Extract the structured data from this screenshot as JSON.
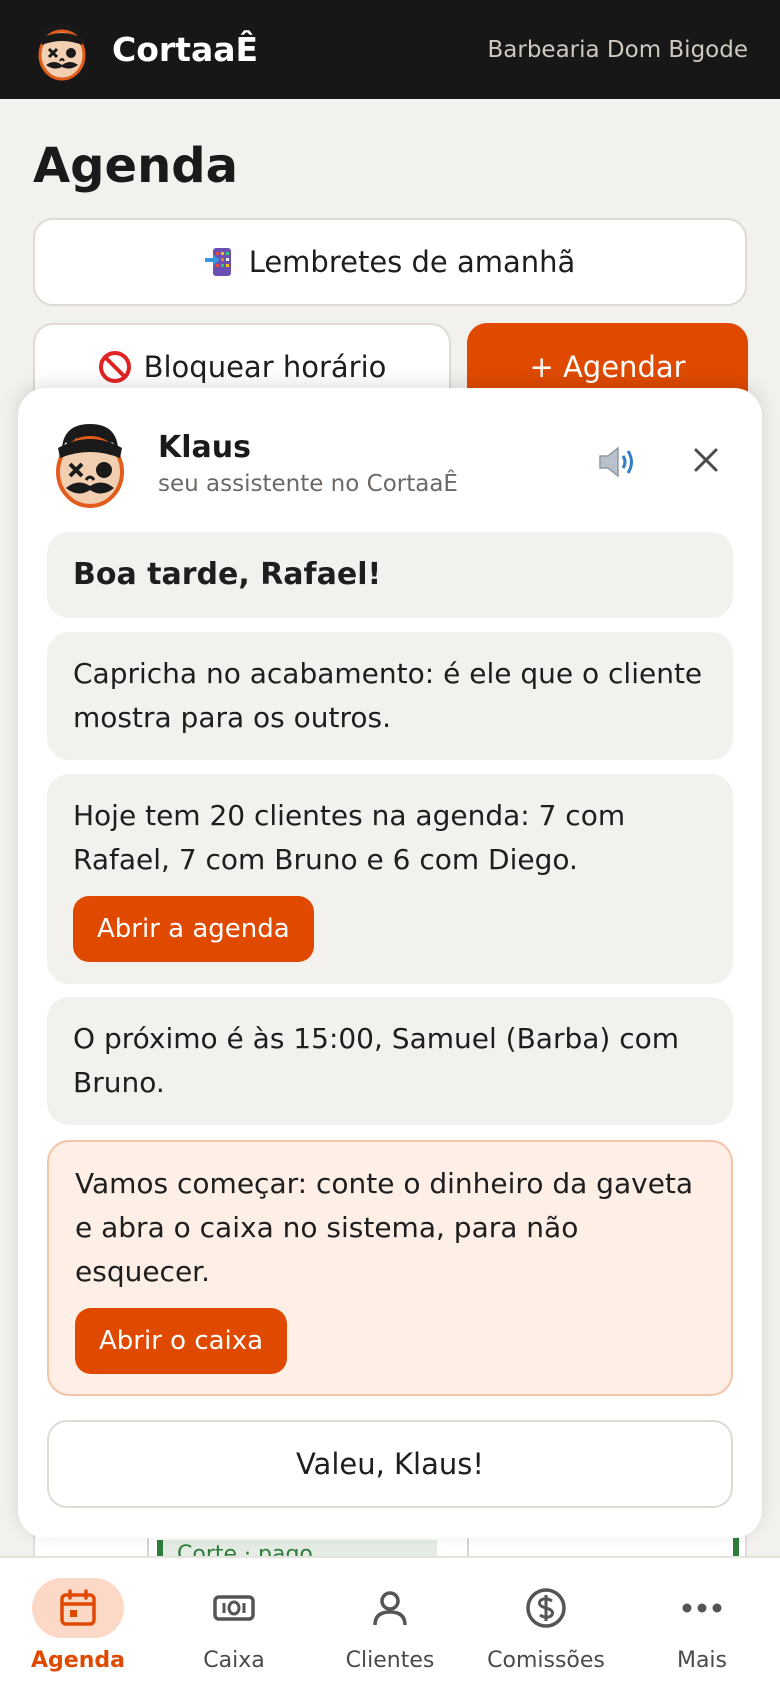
{
  "app": {
    "brand": "CortaaÊ",
    "shop_name": "Barbearia Dom Bigode"
  },
  "page": {
    "title": "Agenda",
    "reminders_button": "Lembretes de amanhã",
    "block_button": "Bloquear horário",
    "schedule_button": "+ Agendar",
    "background_slot": "Corte · pago"
  },
  "assistant": {
    "name": "Klaus",
    "subtitle": "seu assistente no CortaaÊ",
    "greeting": "Boa tarde, Rafael!",
    "tip": "Capricha no acabamento: é ele que o cliente mostra para os outros.",
    "summary": "Hoje tem 20 clientes na agenda: 7 com Rafael, 7 com Bruno e 6 com Diego.",
    "summary_action": "Abrir a agenda",
    "next": "O próximo é às 15:00, Samuel (Barba) com Bruno.",
    "cash_prompt": "Vamos começar: conte o dinheiro da gaveta e abra o caixa no sistema, para não esquecer.",
    "cash_action": "Abrir o caixa",
    "thanks_button": "Valeu, Klaus!"
  },
  "nav": {
    "items": [
      {
        "label": "Agenda",
        "icon": "calendar-icon",
        "active": true
      },
      {
        "label": "Caixa",
        "icon": "cash-icon",
        "active": false
      },
      {
        "label": "Clientes",
        "icon": "person-icon",
        "active": false
      },
      {
        "label": "Comissões",
        "icon": "dollar-circle-icon",
        "active": false
      },
      {
        "label": "Mais",
        "icon": "more-dots-icon",
        "active": false
      }
    ]
  },
  "colors": {
    "accent": "#df4a00",
    "topbar": "#171717",
    "page_bg": "#f3f1ee",
    "cash_bubble_bg": "#fdeee6"
  }
}
